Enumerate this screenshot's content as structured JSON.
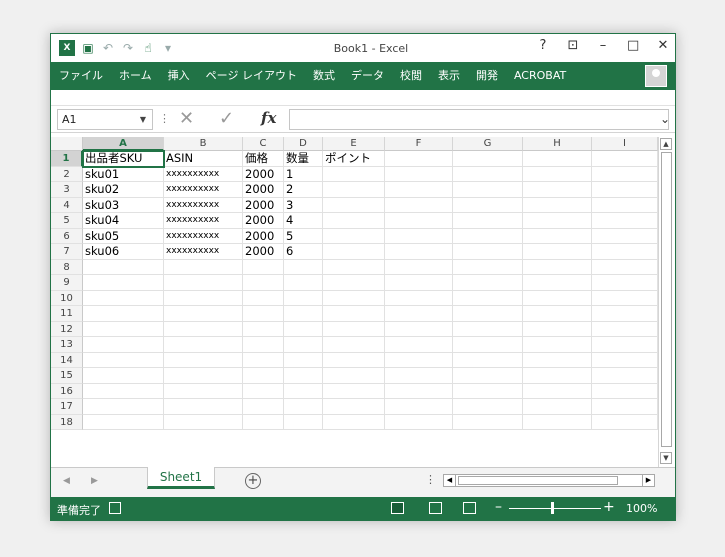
{
  "window": {
    "title": "Book1 - Excel"
  },
  "titlebar_controls": {
    "help": "?",
    "restore": "⊡",
    "minimize": "–",
    "maximize": "□",
    "close": "✕"
  },
  "ribbon": {
    "tabs": [
      "ファイル",
      "ホーム",
      "挿入",
      "ページ レイアウト",
      "数式",
      "データ",
      "校閲",
      "表示",
      "開発",
      "ACROBAT"
    ]
  },
  "formula_bar": {
    "name_box": "A1",
    "cancel_symbol": "✕",
    "enter_symbol": "✓",
    "fx_symbol": "fx",
    "formula": ""
  },
  "grid": {
    "columns": [
      "A",
      "B",
      "C",
      "D",
      "E",
      "F",
      "G",
      "H",
      "I"
    ],
    "rows": [
      "1",
      "2",
      "3",
      "4",
      "5",
      "6",
      "7",
      "8",
      "9",
      "10",
      "11",
      "12",
      "13",
      "14",
      "15",
      "16",
      "17",
      "18"
    ],
    "cells": [
      [
        "出品者SKU",
        "ASIN",
        "価格",
        "数量",
        "ポイント"
      ],
      [
        "sku01",
        "xxxxxxxxxx",
        "2000",
        "1",
        ""
      ],
      [
        "sku02",
        "xxxxxxxxxx",
        "2000",
        "2",
        ""
      ],
      [
        "sku03",
        "xxxxxxxxxx",
        "2000",
        "3",
        ""
      ],
      [
        "sku04",
        "xxxxxxxxxx",
        "2000",
        "4",
        ""
      ],
      [
        "sku05",
        "xxxxxxxxxx",
        "2000",
        "5",
        ""
      ],
      [
        "sku06",
        "xxxxxxxxxx",
        "2000",
        "6",
        ""
      ]
    ]
  },
  "sheet_tabs": {
    "active": "Sheet1",
    "add": "+"
  },
  "status_bar": {
    "status": "準備完了",
    "zoom": "100%"
  },
  "colors": {
    "accent": "#217346"
  }
}
